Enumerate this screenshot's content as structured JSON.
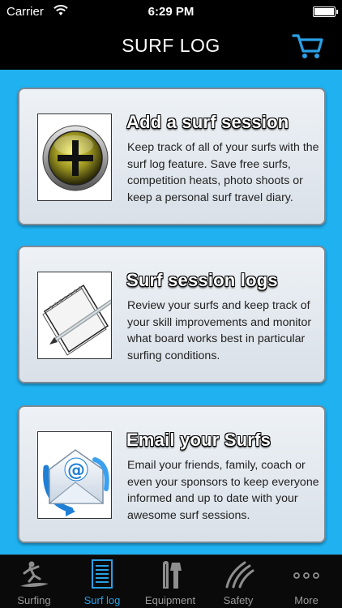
{
  "status_bar": {
    "carrier": "Carrier",
    "time": "6:29 PM"
  },
  "nav": {
    "title": "SURF LOG",
    "cart_icon": "shopping-cart-icon"
  },
  "colors": {
    "background": "#1fb1f0",
    "accent": "#2aa0e6",
    "bar": "#000000"
  },
  "cards": [
    {
      "title": "Add a surf session",
      "description": "Keep track of all of your surfs with the surf log feature. Save free surfs, competition heats, photo shoots or keep a personal surf travel diary.",
      "icon": "add-plus-icon"
    },
    {
      "title": "Surf session logs",
      "description": "Review your surfs and keep track of your skill improvements and monitor what board works best in particular surfing conditions.",
      "icon": "notepad-pen-icon"
    },
    {
      "title": "Email your Surfs",
      "description": "Email your friends, family, coach or even your sponsors to keep everyone informed and up to date with your awesome surf sessions.",
      "icon": "email-envelope-icon"
    }
  ],
  "tabs": [
    {
      "label": "Surfing",
      "icon": "surfer-icon",
      "active": false
    },
    {
      "label": "Surf log",
      "icon": "document-icon",
      "active": true
    },
    {
      "label": "Equipment",
      "icon": "wetsuit-icon",
      "active": false
    },
    {
      "label": "Safety",
      "icon": "waves-icon",
      "active": false
    },
    {
      "label": "More",
      "icon": "more-dots-icon",
      "active": false
    }
  ]
}
